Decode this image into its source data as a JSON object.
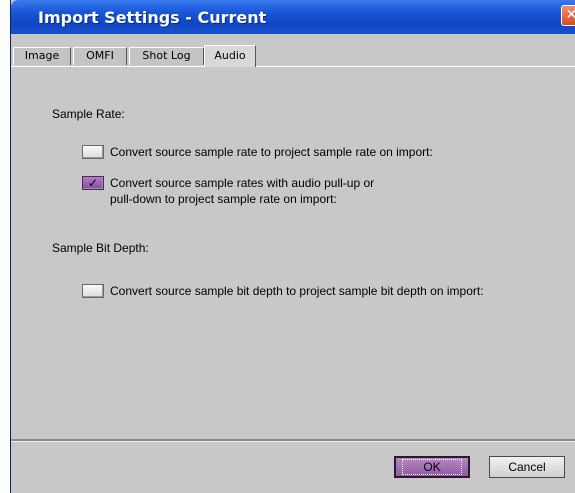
{
  "window": {
    "title": "Import Settings - Current",
    "close_glyph": "✕"
  },
  "tabs": [
    {
      "label": "Image",
      "active": false
    },
    {
      "label": "OMFI",
      "active": false
    },
    {
      "label": "Shot Log",
      "active": false
    },
    {
      "label": "Audio",
      "active": true
    }
  ],
  "sample_rate": {
    "heading": "Sample Rate:",
    "options": [
      {
        "label": "Convert source sample rate to project sample rate on import:",
        "checked": false
      },
      {
        "label_line1": "Convert source sample rates with audio pull-up or",
        "label_line2": "pull-down to project sample rate on import:",
        "checked": true
      }
    ]
  },
  "bit_depth": {
    "heading": "Sample Bit Depth:",
    "option": {
      "label": "Convert source sample bit depth to project sample bit depth on import:",
      "checked": false
    }
  },
  "buttons": {
    "ok": "OK",
    "cancel": "Cancel"
  },
  "colors": {
    "titlebar": "#1957d6",
    "accent_purple": "#8f5ba0",
    "dialog_bg": "#c8c8c8"
  }
}
